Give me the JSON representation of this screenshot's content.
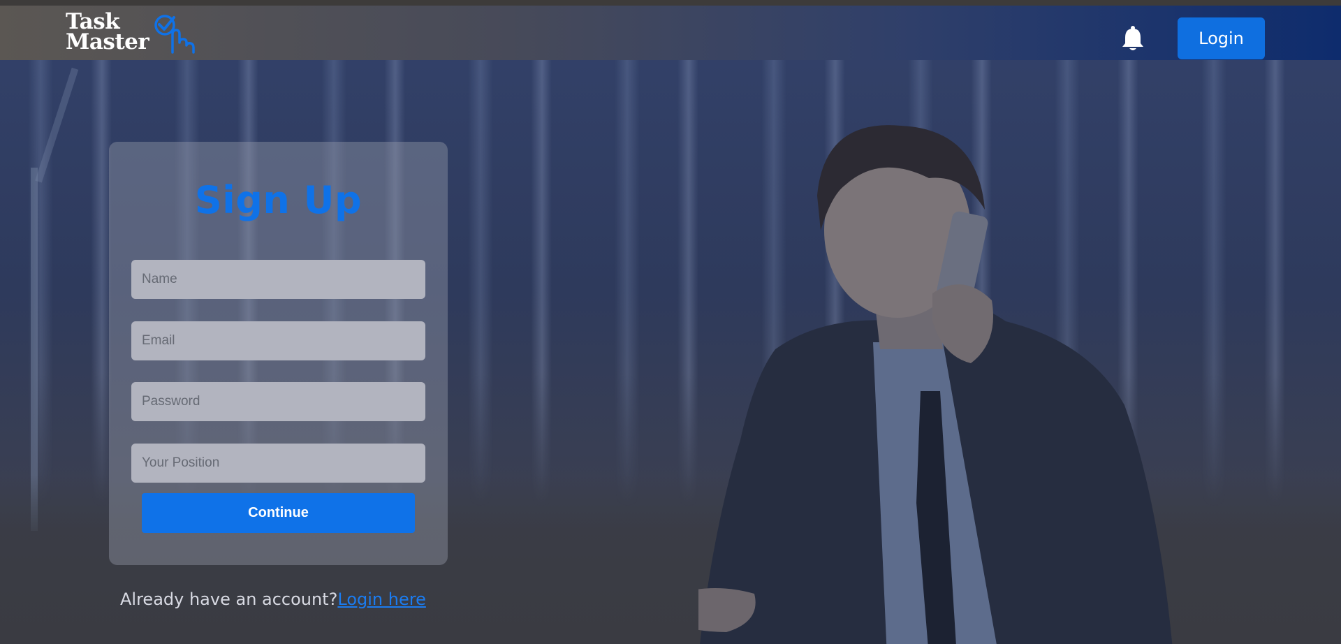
{
  "brand": {
    "line1": "Task",
    "line2": "Master",
    "accent_color": "#0f72e8",
    "logo_icon": "check-hand-icon"
  },
  "navbar": {
    "notification_icon": "bell-icon",
    "login_label": "Login"
  },
  "signup": {
    "title": "Sign Up",
    "fields": {
      "name_placeholder": "Name",
      "email_placeholder": "Email",
      "password_placeholder": "Password",
      "position_placeholder": "Your Position"
    },
    "continue_label": "Continue"
  },
  "footer_prompt": {
    "text": "Already have an account?",
    "link_label": "Login here"
  },
  "colors": {
    "primary": "#0f72e8",
    "navbar_end": "#0e2c6d",
    "input_bg": "#b2b4bf"
  }
}
